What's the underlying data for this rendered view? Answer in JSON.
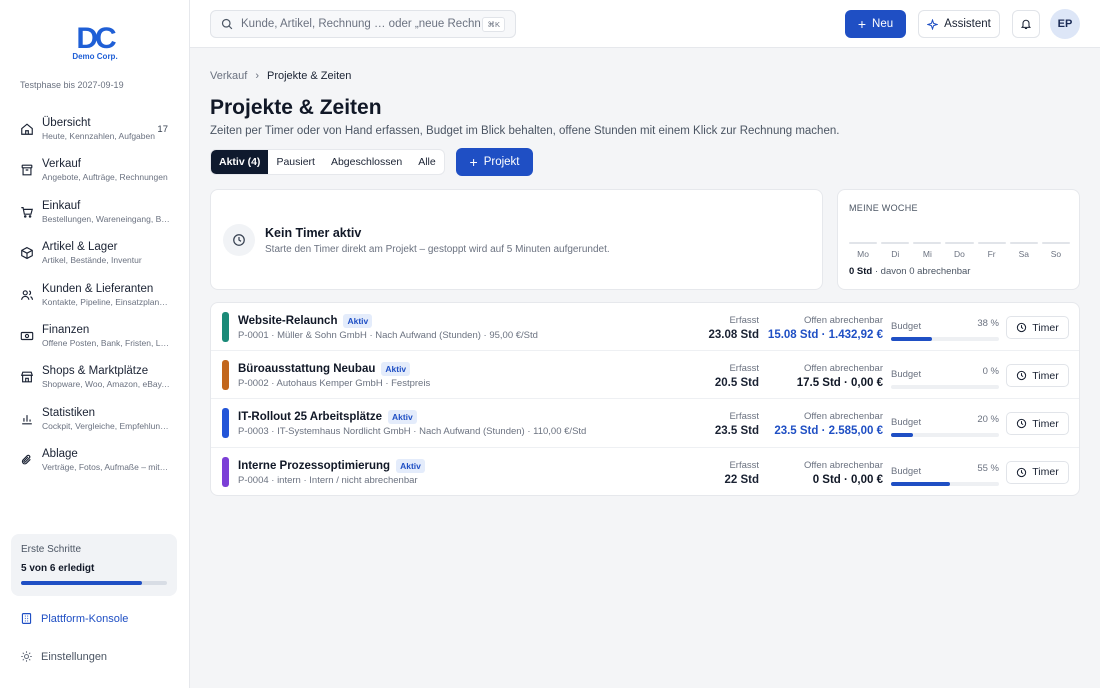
{
  "brand": {
    "logo_text": "DC",
    "logo_sub": "Demo Corp.",
    "trial": "Testphase bis 2027-09-19"
  },
  "sidebar": {
    "items": [
      {
        "label": "Übersicht",
        "sub": "Heute, Kennzahlen, Aufgaben",
        "count": "17",
        "icon": "home-icon"
      },
      {
        "label": "Verkauf",
        "sub": "Angebote, Aufträge, Rechnungen",
        "count": "",
        "icon": "archive-icon"
      },
      {
        "label": "Einkauf",
        "sub": "Bestellungen, Wareneingang, Belege",
        "count": "",
        "icon": "cart-icon"
      },
      {
        "label": "Artikel & Lager",
        "sub": "Artikel, Bestände, Inventur",
        "count": "",
        "icon": "box-icon"
      },
      {
        "label": "Kunden & Lieferanten",
        "sub": "Kontakte, Pipeline, Einsatzplan, Lieferanten",
        "count": "",
        "icon": "users-icon"
      },
      {
        "label": "Finanzen",
        "sub": "Offene Posten, Bank, Fristen, Liquidität",
        "count": "",
        "icon": "money-icon"
      },
      {
        "label": "Shops & Marktplätze",
        "sub": "Shopware, Woo, Amazon, eBay, Etsy",
        "count": "",
        "icon": "shop-icon"
      },
      {
        "label": "Statistiken",
        "sub": "Cockpit, Vergleiche, Empfehlungen",
        "count": "",
        "icon": "chart-icon"
      },
      {
        "label": "Ablage",
        "sub": "Verträge, Fotos, Aufmaße – mit Suche",
        "count": "",
        "icon": "paperclip-icon"
      }
    ],
    "steps": {
      "title": "Erste Schritte",
      "value": "5 von 6 erledigt",
      "progress": 0.83
    },
    "konsole": "Plattform-Konsole",
    "settings": "Einstellungen"
  },
  "topbar": {
    "search_placeholder": "Kunde, Artikel, Rechnung … oder „neue Rechnung“",
    "shortcut": "⌘K",
    "new_label": "Neu",
    "assistant_label": "Assistent",
    "avatar": "EP"
  },
  "breadcrumb": {
    "parent": "Verkauf",
    "sep": "›",
    "current": "Projekte & Zeiten"
  },
  "page": {
    "title": "Projekte & Zeiten",
    "subtitle": "Zeiten per Timer oder von Hand erfassen, Budget im Blick behalten, offene Stunden mit einem Klick zur Rechnung machen."
  },
  "tabs": [
    {
      "label": "Aktiv (4)",
      "active": true
    },
    {
      "label": "Pausiert",
      "active": false
    },
    {
      "label": "Abgeschlossen",
      "active": false
    },
    {
      "label": "Alle",
      "active": false
    }
  ],
  "project_button": "Projekt",
  "timer": {
    "title": "Kein Timer aktiv",
    "desc": "Starte den Timer direkt am Projekt – gestoppt wird auf 5 Minuten aufgerundet."
  },
  "week": {
    "title": "MEINE WOCHE",
    "days": [
      "Mo",
      "Di",
      "Mi",
      "Do",
      "Fr",
      "Sa",
      "So"
    ],
    "total": "0 Std",
    "rest": "· davon 0 abrechenbar"
  },
  "labels": {
    "erfasst": "Erfasst",
    "offen": "Offen abrechenbar",
    "budget": "Budget",
    "timer": "Timer"
  },
  "projects": [
    {
      "name": "Website-Relaunch",
      "status": "Aktiv",
      "meta": "P-0001 · Müller & Sohn GmbH · Nach Aufwand (Stunden) · 95,00 €/Std",
      "color": "#1a8a78",
      "erfasst": "23.08 Std",
      "offen": "15.08 Std · 1.432,92 €",
      "offen_highlight": true,
      "budget_pct": "38 %",
      "budget": 0.38
    },
    {
      "name": "Büroausstattung Neubau",
      "status": "Aktiv",
      "meta": "P-0002 · Autohaus Kemper GmbH · Festpreis",
      "color": "#c2661c",
      "erfasst": "20.5 Std",
      "offen": "17.5 Std · 0,00 €",
      "offen_highlight": false,
      "budget_pct": "0 %",
      "budget": 0
    },
    {
      "name": "IT-Rollout 25 Arbeitsplätze",
      "status": "Aktiv",
      "meta": "P-0003 · IT-Systemhaus Nordlicht GmbH · Nach Aufwand (Stunden) · 110,00 €/Std",
      "color": "#2355d8",
      "erfasst": "23.5 Std",
      "offen": "23.5 Std · 2.585,00 €",
      "offen_highlight": true,
      "budget_pct": "20 %",
      "budget": 0.2
    },
    {
      "name": "Interne Prozessoptimierung",
      "status": "Aktiv",
      "meta": "P-0004 · intern · Intern / nicht abrechenbar",
      "color": "#7b3fd6",
      "erfasst": "22 Std",
      "offen": "0 Std · 0,00 €",
      "offen_highlight": false,
      "budget_pct": "55 %",
      "budget": 0.55
    }
  ]
}
